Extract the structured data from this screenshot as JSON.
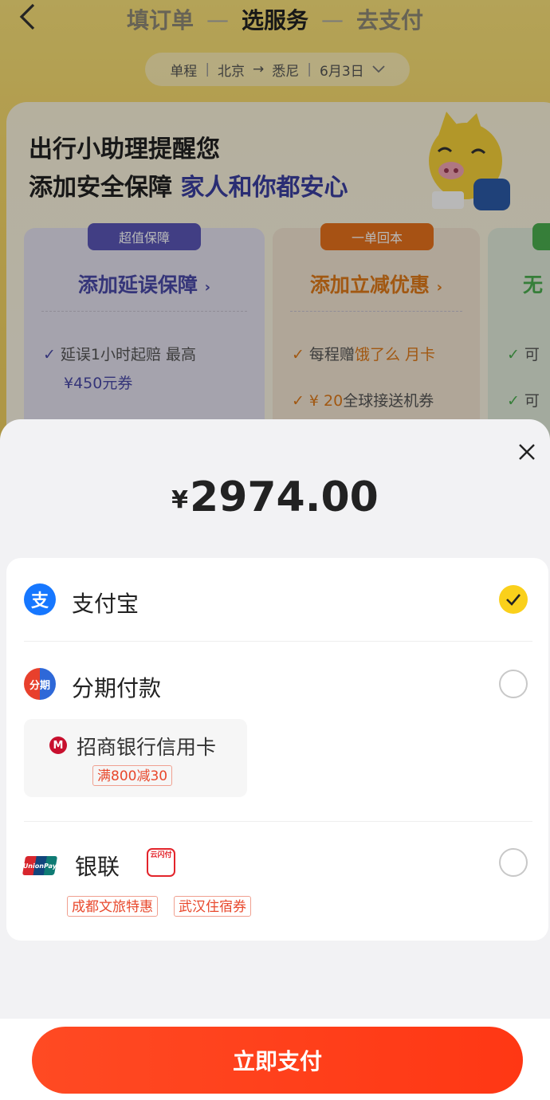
{
  "header": {
    "back_icon": "chevron-left-icon",
    "steps": [
      "填订单",
      "选服务",
      "去支付"
    ],
    "active_step": 1,
    "trip": {
      "type": "单程",
      "from": "北京",
      "to": "悉尼",
      "date": "6月3日"
    }
  },
  "reminder": {
    "line1": "出行小助理提醒您",
    "line2_prefix": "添加安全保障",
    "line2_highlight": "家人和你都安心"
  },
  "cards": [
    {
      "badge": "超值保障",
      "title": "添加延误保障",
      "lines": [
        {
          "text": "延误1小时起赔 最高"
        },
        {
          "highlight": "¥450元券"
        }
      ]
    },
    {
      "badge": "一单回本",
      "title": "添加立减优惠",
      "lines": [
        {
          "text": "每程赠",
          "highlight": "饿了么 月卡"
        },
        {
          "highlight": "¥ 20",
          "text": "全球接送机券"
        }
      ]
    },
    {
      "badge": "",
      "title": "无",
      "lines": [
        {
          "text": "可"
        },
        {
          "text": "可"
        }
      ]
    }
  ],
  "payment": {
    "close_icon": "close-icon",
    "currency": "¥",
    "amount": "2974.00",
    "methods": [
      {
        "name": "支付宝",
        "icon": "alipay-icon",
        "icon_glyph": "支",
        "selected": true
      },
      {
        "name": "分期付款",
        "icon": "installment-icon",
        "icon_glyph": "分期",
        "selected": false,
        "bank": {
          "name": "招商银行信用卡",
          "logo": "cmb-logo-icon",
          "promo": "满800减30"
        }
      },
      {
        "name": "银联",
        "icon": "unionpay-icon",
        "icon_glyph": "UnionPay",
        "selected": false,
        "extra_icon": "yunshanfu-icon",
        "extra_icon_glyph": "云闪付",
        "tags": [
          "成都文旅特惠",
          "武汉住宿券"
        ]
      }
    ],
    "pay_button": "立即支付"
  },
  "colors": {
    "accent": "#fad01b",
    "pay_button": "#ff4223",
    "alipay": "#1677ff",
    "protect_purple": "#4a4aa8",
    "promo_orange": "#e07a1a"
  }
}
